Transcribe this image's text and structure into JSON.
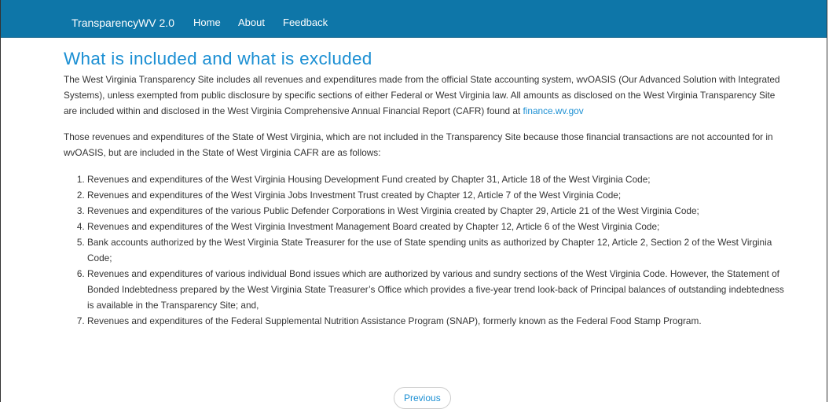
{
  "nav": {
    "brand": "TransparencyWV 2.0",
    "links": [
      "Home",
      "About",
      "Feedback"
    ]
  },
  "main": {
    "title": "What is included and what is excluded",
    "intro_text": "The West Virginia Transparency Site includes all revenues and expenditures made from the official State accounting system, wvOASIS (Our Advanced Solution with Integrated Systems), unless exempted from public disclosure by specific sections of either Federal or West Virginia law. All amounts as disclosed on the West Virginia Transparency Site are included within and disclosed in the West Virginia Comprehensive Annual Financial Report (CAFR) found at ",
    "intro_link": "finance.wv.gov",
    "second_text": "Those revenues and expenditures of the State of West Virginia, which are not included in the Transparency Site because those financial transactions are not accounted for in wvOASIS, but are included in the State of West Virginia CAFR are as follows:",
    "items": [
      "Revenues and expenditures of the West Virginia Housing Development Fund created by Chapter 31, Article 18 of the West Virginia Code;",
      "Revenues and expenditures of the West Virginia Jobs Investment Trust created by Chapter 12, Article 7 of the West Virginia Code;",
      "Revenues and expenditures of the various Public Defender Corporations in West Virginia created by Chapter 29, Article 21 of the West Virginia Code;",
      "Revenues and expenditures of the West Virginia Investment Management Board created by Chapter 12, Article 6 of the West Virginia Code;",
      "Bank accounts authorized by the West Virginia State Treasurer for the use of State spending units as authorized by Chapter 12, Article 2, Section 2 of the West Virginia Code;",
      "Revenues and expenditures of various individual Bond issues which are authorized by various and sundry sections of the West Virginia Code. However, the Statement of Bonded Indebtedness prepared by the West Virginia State Treasurer’s Office which provides a five-year trend look-back of Principal balances of outstanding indebtedness is available in the Transparency Site; and,",
      "Revenues and expenditures of the Federal Supplemental Nutrition Assistance Program (SNAP), formerly known as the Federal Food Stamp Program."
    ]
  },
  "pager": {
    "previous_label": "Previous"
  },
  "colors": {
    "navbar": "#0e76a8",
    "heading": "#1b8fd3",
    "text": "#333333"
  }
}
